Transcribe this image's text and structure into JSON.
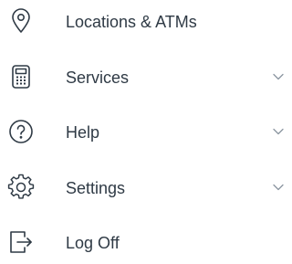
{
  "menu": {
    "items": [
      {
        "label": "Locations & ATMs",
        "icon": "map-pin-icon",
        "expandable": false
      },
      {
        "label": "Services",
        "icon": "calculator-icon",
        "expandable": true
      },
      {
        "label": "Help",
        "icon": "help-circle-icon",
        "expandable": true
      },
      {
        "label": "Settings",
        "icon": "gear-icon",
        "expandable": true
      },
      {
        "label": "Log Off",
        "icon": "log-off-icon",
        "expandable": false
      }
    ]
  },
  "colors": {
    "text": "#2f3a45",
    "icon": "#2f3a45",
    "chevron": "#8a959f",
    "background": "#ffffff"
  }
}
